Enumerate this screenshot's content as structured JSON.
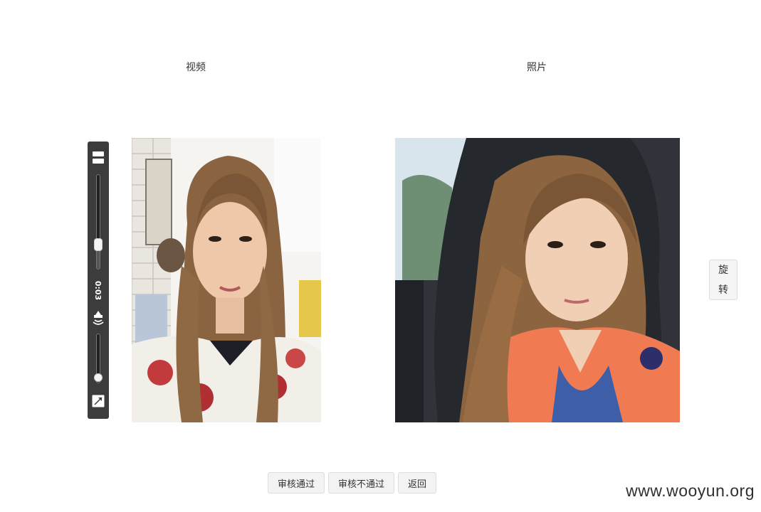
{
  "labels": {
    "video": "视频",
    "photo": "照片"
  },
  "player": {
    "time": "0:03",
    "progress": 0.25,
    "volume": 0.1
  },
  "rotate": {
    "char1": "旋",
    "char2": "转"
  },
  "actions": {
    "approve": "审核通过",
    "reject": "审核不通过",
    "back": "返回"
  },
  "watermark": "www.wooyun.org",
  "colors": {
    "player_bg": "#3c3c3c",
    "button_bg": "#f3f3f3"
  }
}
